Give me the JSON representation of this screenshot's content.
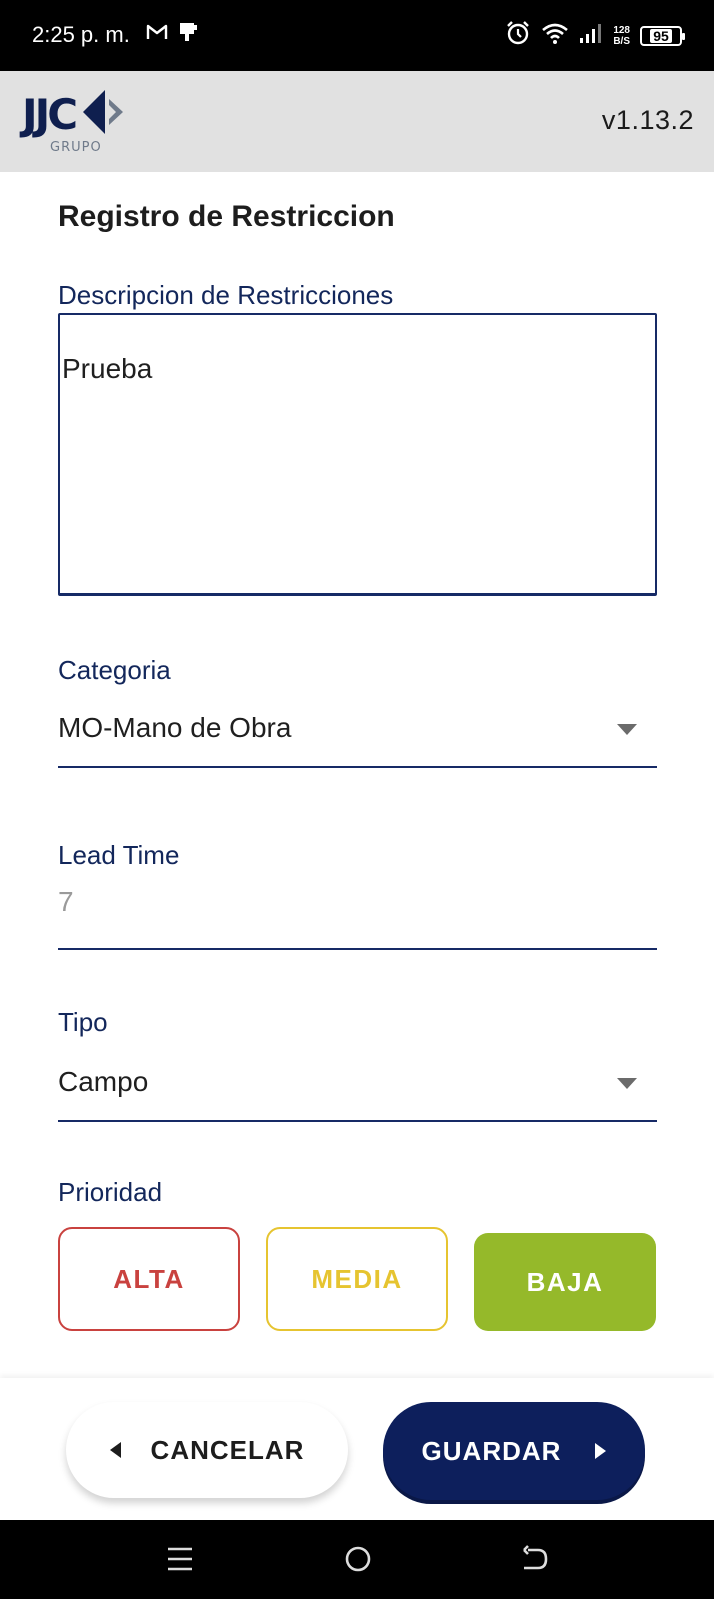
{
  "status_bar": {
    "time": "2:25 p. m.",
    "speed_top": "128",
    "speed_bottom": "B/S",
    "battery": "95",
    "icons": [
      "gmail-icon",
      "notification-icon",
      "alarm-icon",
      "wifi-icon",
      "signal-icon",
      "battery-icon"
    ]
  },
  "header": {
    "logo_text": "JJC",
    "logo_sub": "GRUPO",
    "version": "v1.13.2"
  },
  "form": {
    "title": "Registro de Restriccion",
    "description": {
      "label": "Descripcion de Restricciones",
      "value": "Prueba"
    },
    "category": {
      "label": "Categoria",
      "value": "MO-Mano de Obra"
    },
    "lead_time": {
      "label": "Lead Time",
      "value": "7"
    },
    "type": {
      "label": "Tipo",
      "value": "Campo"
    },
    "priority": {
      "label": "Prioridad",
      "options": [
        "ALTA",
        "MEDIA",
        "BAJA"
      ],
      "selected": "BAJA"
    }
  },
  "actions": {
    "cancel_label": "CANCELAR",
    "save_label": "GUARDAR"
  },
  "colors": {
    "brand_navy": "#0d1f5c",
    "label_blue": "#13275b",
    "alta": "#c9423f",
    "media": "#e6c430",
    "baja": "#95b92a",
    "header_bg": "#e1e1e1"
  }
}
